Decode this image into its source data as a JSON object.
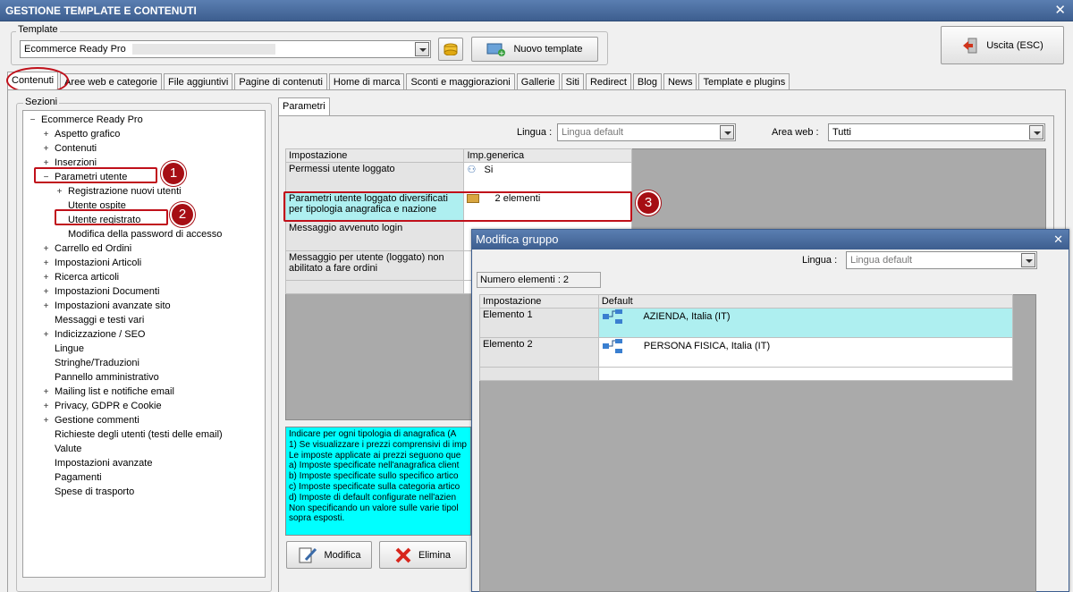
{
  "window": {
    "title": "GESTIONE TEMPLATE E CONTENUTI"
  },
  "template": {
    "group_label": "Template",
    "selected": "Ecommerce Ready Pro",
    "new_button": "Nuovo template"
  },
  "exit_button": "Uscita (ESC)",
  "tabs": [
    "Contenuti",
    "Aree web e categorie",
    "File aggiuntivi",
    "Pagine di contenuti",
    "Home di marca",
    "Sconti e maggiorazioni",
    "Gallerie",
    "Siti",
    "Redirect",
    "Blog",
    "News",
    "Template e plugins"
  ],
  "sections": {
    "label": "Sezioni",
    "items": [
      {
        "label": "Ecommerce Ready Pro",
        "exp": "−"
      },
      {
        "label": "Aspetto grafico",
        "exp": "+"
      },
      {
        "label": "Contenuti",
        "exp": "+"
      },
      {
        "label": "Inserzioni",
        "exp": "+"
      },
      {
        "label": "Parametri utente",
        "exp": "−"
      },
      {
        "label": "Registrazione nuovi utenti",
        "exp": "+"
      },
      {
        "label": "Utente ospite",
        "exp": ""
      },
      {
        "label": "Utente registrato",
        "exp": ""
      },
      {
        "label": "Modifica della password di accesso",
        "exp": ""
      },
      {
        "label": "Carrello ed Ordini",
        "exp": "+"
      },
      {
        "label": "Impostazioni Articoli",
        "exp": "+"
      },
      {
        "label": "Ricerca articoli",
        "exp": "+"
      },
      {
        "label": "Impostazioni Documenti",
        "exp": "+"
      },
      {
        "label": "Impostazioni avanzate sito",
        "exp": "+"
      },
      {
        "label": "Messaggi e testi vari",
        "exp": ""
      },
      {
        "label": "Indicizzazione / SEO",
        "exp": "+"
      },
      {
        "label": "Lingue",
        "exp": ""
      },
      {
        "label": "Stringhe/Traduzioni",
        "exp": ""
      },
      {
        "label": "Pannello amministrativo",
        "exp": ""
      },
      {
        "label": "Mailing list e notifiche email",
        "exp": "+"
      },
      {
        "label": "Privacy, GDPR e Cookie",
        "exp": "+"
      },
      {
        "label": "Gestione commenti",
        "exp": "+"
      },
      {
        "label": "Richieste degli utenti (testi delle email)",
        "exp": ""
      },
      {
        "label": "Valute",
        "exp": ""
      },
      {
        "label": "Impostazioni avanzate",
        "exp": ""
      },
      {
        "label": "Pagamenti",
        "exp": ""
      },
      {
        "label": "Spese di trasporto",
        "exp": ""
      }
    ]
  },
  "params": {
    "tab": "Parametri",
    "lingua_label": "Lingua :",
    "lingua_value": "Lingua default",
    "area_label": "Area web :",
    "area_value": "Tutti",
    "headers": [
      "Impostazione",
      "Imp.generica"
    ],
    "rows": [
      {
        "name": "Permessi utente loggato",
        "value": "Si"
      },
      {
        "name": "Parametri utente loggato diversificati per tipologia anagrafica e nazione",
        "value": "2 elementi"
      },
      {
        "name": "Messaggio avvenuto login",
        "value": ""
      },
      {
        "name": "Messaggio per utente (loggato) non abilitato a fare ordini",
        "value": ""
      }
    ],
    "description": [
      "Indicare per ogni tipologia di anagrafica (A",
      "1) Se visualizzare i prezzi comprensivi di imp",
      "Le imposte applicate ai prezzi seguono que",
      "a) Imposte specificate nell'anagrafica client",
      "b) Imposte specificate sullo specifico artico",
      "c) Imposte specificate sulla categoria artico",
      "d) Imposte di default configurate nell'azien",
      "Non specificando un valore sulle varie tipol",
      "sopra esposti."
    ],
    "edit_button": "Modifica",
    "delete_button": "Elimina"
  },
  "badges": [
    "1",
    "2",
    "3"
  ],
  "dialog": {
    "title": "Modifica gruppo",
    "lingua_label": "Lingua :",
    "lingua_value": "Lingua default",
    "count_label": "Numero elementi : 2",
    "headers": [
      "Impostazione",
      "Default"
    ],
    "rows": [
      {
        "name": "Elemento 1",
        "value": "AZIENDA, Italia (IT)"
      },
      {
        "name": "Elemento 2",
        "value": "PERSONA FISICA, Italia (IT)"
      }
    ]
  },
  "colors": {
    "accent": "#3d5e8f",
    "highlight": "#aeeff0",
    "description_bg": "#00ffff",
    "annotation": "#c0101a"
  }
}
